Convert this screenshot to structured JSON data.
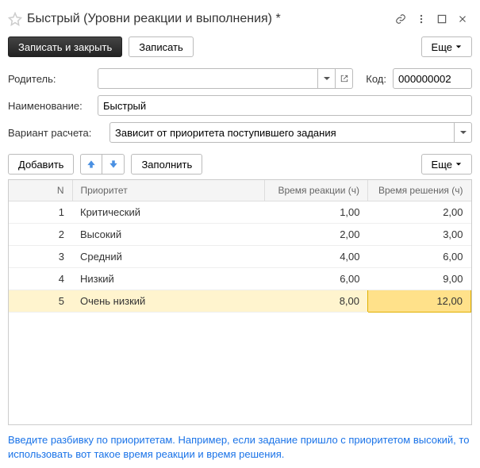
{
  "title": "Быстрый (Уровни реакции и выполнения) *",
  "toolbar": {
    "save_close": "Записать и закрыть",
    "save": "Записать",
    "more": "Еще"
  },
  "form": {
    "parent_label": "Родитель:",
    "parent_value": "",
    "code_label": "Код:",
    "code_value": "000000002",
    "name_label": "Наименование:",
    "name_value": "Быстрый",
    "calc_label": "Вариант расчета:",
    "calc_value": "Зависит от приоритета поступившего задания"
  },
  "table_toolbar": {
    "add": "Добавить",
    "fill": "Заполнить",
    "more": "Еще"
  },
  "table": {
    "headers": {
      "n": "N",
      "priority": "Приоритет",
      "reaction": "Время реакции (ч)",
      "resolution": "Время решения (ч)"
    },
    "rows": [
      {
        "n": "1",
        "priority": "Критический",
        "reaction": "1,00",
        "resolution": "2,00"
      },
      {
        "n": "2",
        "priority": "Высокий",
        "reaction": "2,00",
        "resolution": "3,00"
      },
      {
        "n": "3",
        "priority": "Средний",
        "reaction": "4,00",
        "resolution": "6,00"
      },
      {
        "n": "4",
        "priority": "Низкий",
        "reaction": "6,00",
        "resolution": "9,00"
      },
      {
        "n": "5",
        "priority": "Очень низкий",
        "reaction": "8,00",
        "resolution": "12,00"
      }
    ]
  },
  "hint": "Введите разбивку по приоритетам. Например, если задание пришло с приоритетом высокий, то использовать вот такое время реакции и время решения."
}
